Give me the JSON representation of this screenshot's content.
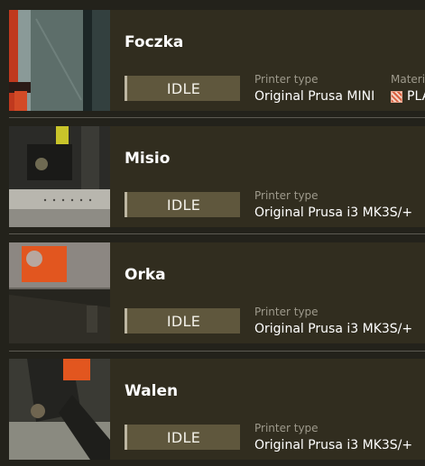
{
  "printers": [
    {
      "name": "Foczka",
      "status": "IDLE",
      "printer_type_label": "Printer type",
      "printer_type": "Original Prusa MINI",
      "material_label": "Materia",
      "material": "PLA"
    },
    {
      "name": "Misio",
      "status": "IDLE",
      "printer_type_label": "Printer type",
      "printer_type": "Original Prusa i3 MK3S/+"
    },
    {
      "name": "Orka",
      "status": "IDLE",
      "printer_type_label": "Printer type",
      "printer_type": "Original Prusa i3 MK3S/+"
    },
    {
      "name": "Walen",
      "status": "IDLE",
      "printer_type_label": "Printer type",
      "printer_type": "Original Prusa i3 MK3S/+"
    }
  ],
  "colors": {
    "card_bg": "#312d1f",
    "status_bg": "#5f573d",
    "accent_orange": "#e2561f"
  }
}
